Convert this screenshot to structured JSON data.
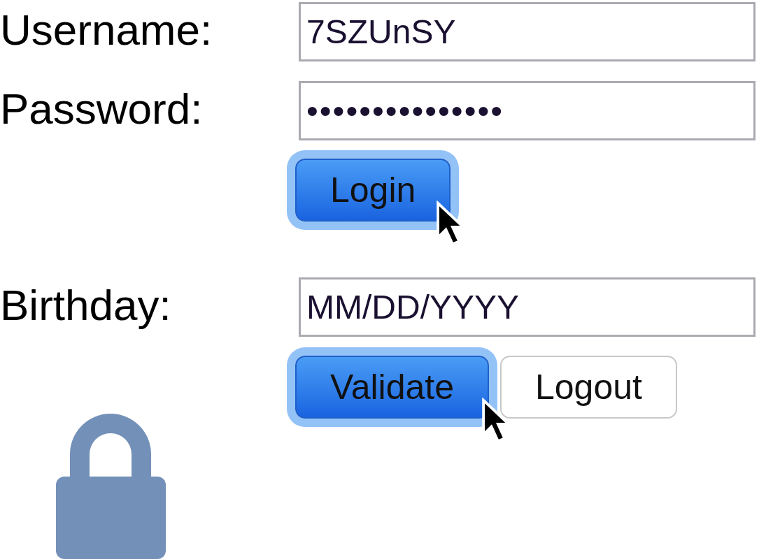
{
  "fields": [
    {
      "label": "Username:",
      "value": "7SZUnSY"
    },
    {
      "label": "Password:",
      "value": "•••••••••••••••"
    }
  ],
  "login_button": {
    "label": "Login",
    "focused": true
  },
  "birthday": {
    "label": "Birthday:",
    "value": "MM/DD/YYYY"
  },
  "buttons": [
    {
      "label": "Validate",
      "focused": true,
      "primary": true
    },
    {
      "label": "Logout",
      "focused": false,
      "primary": false
    }
  ]
}
